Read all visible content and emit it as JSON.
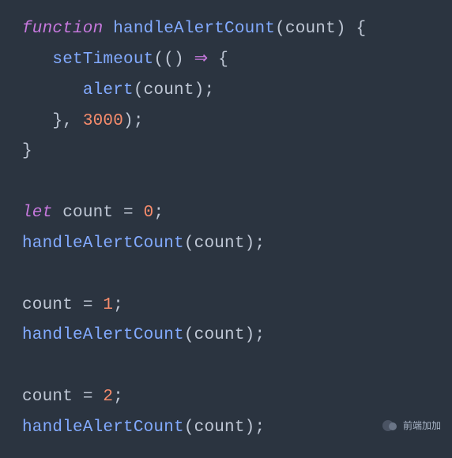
{
  "code": {
    "l1": {
      "kw": "function",
      "sp1": " ",
      "fn": "handleAlertCount",
      "open": "(",
      "param": "count",
      "close": ")",
      "brace": " {"
    },
    "l2": {
      "indent": "   ",
      "call": "setTimeout",
      "open": "((",
      "close": ") ",
      "arrow": "⇒",
      "brace": " {"
    },
    "l3": {
      "indent": "      ",
      "call": "alert",
      "open": "(",
      "param": "count",
      "close": ");"
    },
    "l4": {
      "indent": "   ",
      "close": "}, ",
      "num": "3000",
      "end": ");"
    },
    "l5": {
      "brace": "}"
    },
    "l6": {
      "empty": " "
    },
    "l7": {
      "vartype": "let",
      "sp": " ",
      "name": "count",
      "eq": " = ",
      "num": "0",
      "semi": ";"
    },
    "l8": {
      "call": "handleAlertCount",
      "open": "(",
      "param": "count",
      "close": ");"
    },
    "l9": {
      "empty": " "
    },
    "l10": {
      "name": "count",
      "eq": " = ",
      "num": "1",
      "semi": ";"
    },
    "l11": {
      "call": "handleAlertCount",
      "open": "(",
      "param": "count",
      "close": ");"
    },
    "l12": {
      "empty": " "
    },
    "l13": {
      "name": "count",
      "eq": " = ",
      "num": "2",
      "semi": ";"
    },
    "l14": {
      "call": "handleAlertCount",
      "open": "(",
      "param": "count",
      "close": ");"
    }
  },
  "watermark": {
    "text": "前端加加"
  }
}
